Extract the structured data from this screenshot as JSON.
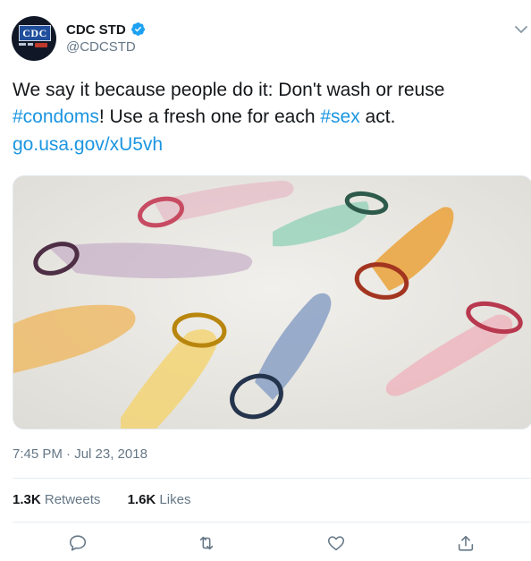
{
  "author": {
    "display_name": "CDC STD",
    "handle": "@CDCSTD",
    "verified": true,
    "avatar_logo_text": "CDC"
  },
  "tweet": {
    "text_part1": "We say it because people do it: Don't wash or reuse ",
    "hashtag1": "#condoms",
    "text_part2": "! Use a fresh one for each ",
    "hashtag2": "#sex",
    "text_part3": " act.",
    "link": "go.usa.gov/xU5vh",
    "timestamp": "7:45 PM · Jul 23, 2018"
  },
  "stats": {
    "retweets_count": "1.3K",
    "retweets_label": "Retweets",
    "likes_count": "1.6K",
    "likes_label": "Likes"
  },
  "actions": [
    "reply-icon",
    "retweet-icon",
    "like-icon",
    "share-icon"
  ],
  "colors": {
    "link_blue": "#1b95e0",
    "verified_blue": "#1da1f2",
    "secondary_text": "#657786",
    "icon_gray": "#657786"
  }
}
